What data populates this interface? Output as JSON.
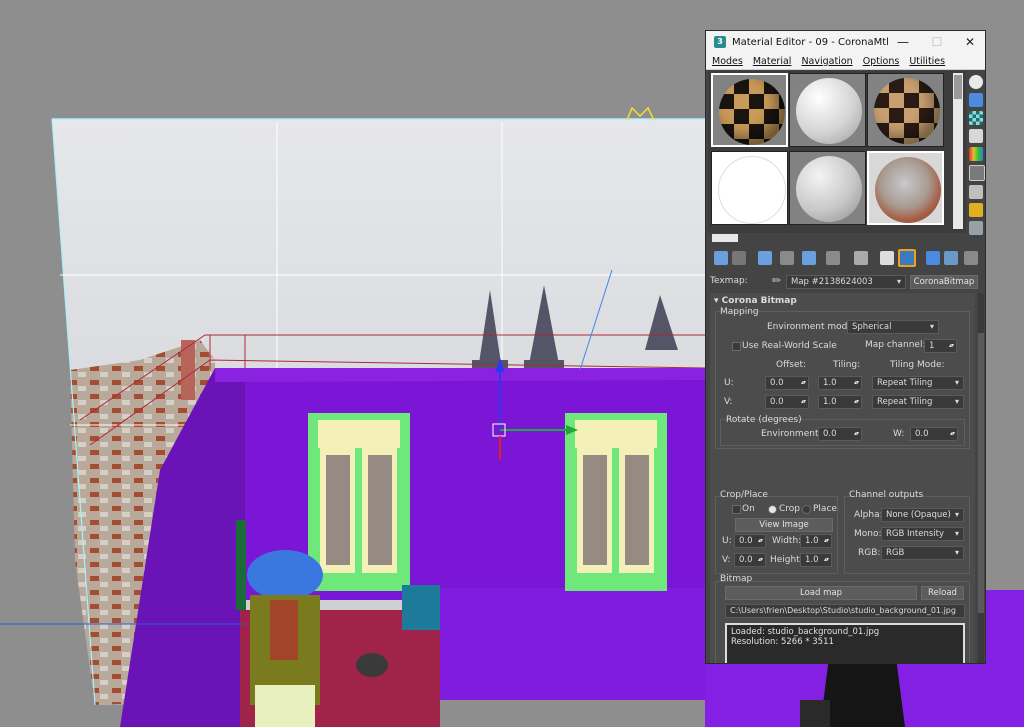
{
  "window": {
    "app_icon": "3",
    "title": "Material Editor - 09 - CoronaMtl",
    "minimize_icon": "minimize-icon",
    "maximize_icon": "maximize-icon",
    "close_icon": "close-icon"
  },
  "menu": [
    "Modes",
    "Material",
    "Navigation",
    "Options",
    "Utilities"
  ],
  "texmap": {
    "label": "Texmap:",
    "map_name": "Map #2138624003",
    "map_type": "CoronaBitmap"
  },
  "rollout": {
    "title": "Corona Bitmap",
    "mapping": {
      "group": "Mapping",
      "env_mode_label": "Environment mode:",
      "env_mode_value": "Spherical",
      "real_world_label": "Use Real-World Scale",
      "map_channel_label": "Map channel:",
      "map_channel_value": "1",
      "offset_label": "Offset:",
      "tiling_label": "Tiling:",
      "tiling_mode_label": "Tiling Mode:",
      "u_label": "U:",
      "v_label": "V:",
      "u_offset": "0.0",
      "u_tiling": "1.0",
      "u_mode": "Repeat Tiling",
      "v_offset": "0.0",
      "v_tiling": "1.0",
      "v_mode": "Repeat Tiling",
      "rotate_label": "Rotate (degrees)",
      "environment_label": "Environment:",
      "environment_value": "0.0",
      "w_label": "W:",
      "w_value": "0.0"
    },
    "crop": {
      "group": "Crop/Place",
      "on_label": "On",
      "crop_label": "Crop",
      "place_label": "Place",
      "view_image": "View Image",
      "u_label": "U:",
      "u_value": "0.0",
      "width_label": "Width:",
      "width_value": "1.0",
      "v_label": "V:",
      "v_value": "0.0",
      "height_label": "Height:",
      "height_value": "1.0"
    },
    "channels": {
      "group": "Channel outputs",
      "alpha_label": "Alpha:",
      "alpha_value": "None (Opaque)",
      "mono_label": "Mono:",
      "mono_value": "RGB Intensity",
      "rgb_label": "RGB:",
      "rgb_value": "RGB"
    },
    "bitmap": {
      "group": "Bitmap",
      "load_map": "Load map",
      "reload": "Reload",
      "path": "C:\\Users\\frien\\Desktop\\Studio\\studio_background_01.jpg",
      "info_line1": "Loaded: studio_background_01.jpg",
      "info_line2": "Resolution: 5266 * 3511"
    }
  },
  "colors": {
    "viewport_bg": "#8e8e8e",
    "room_purple": "#7b16d6",
    "window_green": "#6ee87a",
    "highlight_orange": "#f0a018"
  }
}
